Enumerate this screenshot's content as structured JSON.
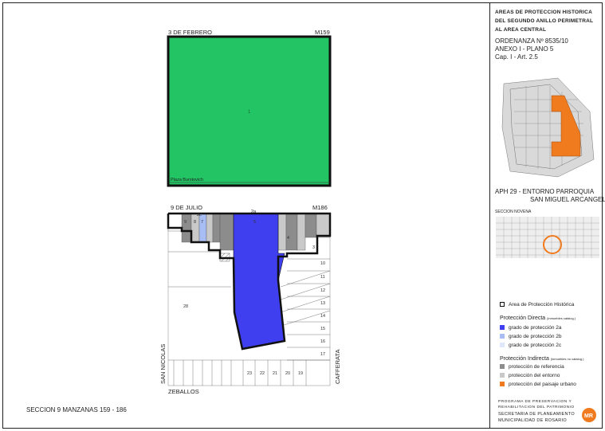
{
  "header": {
    "line1": "AREAS DE PROTECCION HISTORICA",
    "line2": "DEL SEGUNDO ANILLO PERIMETRAL",
    "line3": "AL AREA CENTRAL",
    "ordenanza": "ORDENANZA Nº 8535/10",
    "anexo": "ANEXO I - PLANO 5",
    "cap": "Cap. I - Art. 2.5"
  },
  "aph": {
    "line1": "APH 29 - ENTORNO PARROQUIA",
    "line2": "SAN MIGUEL ARCANGEL"
  },
  "seccion_novena_label": "SECCION NOVENA",
  "map": {
    "street_top": "3 DE FEBRERO",
    "block_top": "M159",
    "plaza": "Plaza Burstovich",
    "plaza_lot": "1",
    "street_mid": "9 DE JULIO",
    "block_mid": "M186",
    "street_left": "SAN NICOLAS",
    "street_right": "CAFFERATA",
    "street_bottom": "ZEBALLOS",
    "lot_2a": "2a",
    "lot_2c": "2c",
    "lot_numbers": [
      "28",
      "10",
      "11",
      "12",
      "13",
      "14",
      "15",
      "16",
      "17",
      "23",
      "22",
      "21",
      "20",
      "19",
      "5",
      "7",
      "8",
      "9",
      "3",
      "4"
    ]
  },
  "footer_left": "SECCION 9  MANZANAS 159 - 186",
  "legend": {
    "area": "Area de Protección Histórica",
    "directa_title": "Protección Directa",
    "directa_note": "(inmuebles catalog.)",
    "directa": [
      "grado de protección 2a",
      "grado de protección 2b",
      "grado de protección 2c"
    ],
    "indirecta_title": "Protección Indirecta",
    "indirecta_note": "(inmuebles no catalog.)",
    "indirecta": [
      "protección de referencia",
      "protección del entorno",
      "protección del paisaje urbano"
    ]
  },
  "colors": {
    "green": "#22c464",
    "blue": "#3f3ff0",
    "light_blue": "#a8bdf3",
    "pale_blue": "#dfe7fb",
    "dark_gray": "#8c8c8c",
    "light_gray": "#c9c9c9",
    "orange": "#f07a1e",
    "logo": "#f07a1e"
  },
  "institution": {
    "line1": "PROGRAMA DE PRESERVACION Y",
    "line2": "REHABILITACION DEL PATRIMONIO",
    "line3": "SECRETARIA DE PLANEAMIENTO",
    "line4": "MUNICIPALIDAD DE ROSARIO",
    "logo": "MR"
  }
}
